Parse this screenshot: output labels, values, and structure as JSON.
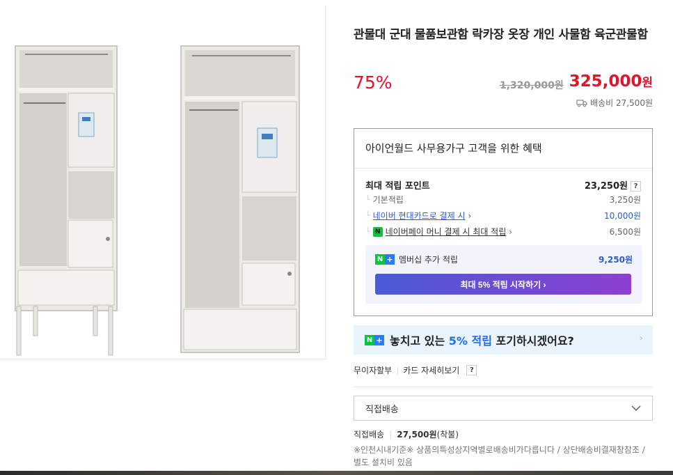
{
  "product": {
    "title": "관물대 군대 물품보관함 락카장 옷장 개인 사물함 육군관물함",
    "discount": "75%",
    "original_price": "1,320,000원",
    "price_number": "325,000",
    "price_unit": "원",
    "shipping_fee": "배송비 27,500원"
  },
  "benefits": {
    "title": "아이언월드 사무용가구 고객을 위한 혜택",
    "max_label": "최대 적립 포인트",
    "max_value": "23,250원",
    "help": "?",
    "base_label": "기본적립",
    "base_value": "3,250원",
    "card_label": "네이버 현대카드로 결제 시",
    "card_value": "10,000원",
    "npay_label": "네이버페이 머니 결제 시 최대 적립",
    "npay_value": "6,500원",
    "npay_icon": "N",
    "membership_label": "멤버십 추가 적립",
    "membership_value": "9,250원",
    "membership_button": "최대 5% 적립 시작하기 ›",
    "arrow": "›"
  },
  "promo": {
    "text_pre": "놓치고 있는",
    "text_highlight": "5% 적립",
    "text_post": "포기하시겠어요?",
    "arrow": "›"
  },
  "payment": {
    "installment": "무이자할부",
    "card_detail": "카드 자세히보기",
    "help": "?"
  },
  "delivery": {
    "selected": "직접배송",
    "label": "직접배송",
    "fee": "27,500원",
    "fee_type": "(착불)",
    "note": "※인천시내기준※ 상품의특성상지역별로배송비가다릅니다 / 상단배송비결재창참조 / 별도 설치비 있음"
  },
  "colors": {
    "sale_red": "#e5132a",
    "link_blue": "#2e5cc6",
    "naver_green": "#00c73c",
    "membership_gradient": [
      "#4a5bd9",
      "#8d3fd0"
    ]
  },
  "icons": {
    "truck": "truck-icon",
    "chevron": "chevron-down-icon",
    "nplus": "naver-plus-icon"
  }
}
